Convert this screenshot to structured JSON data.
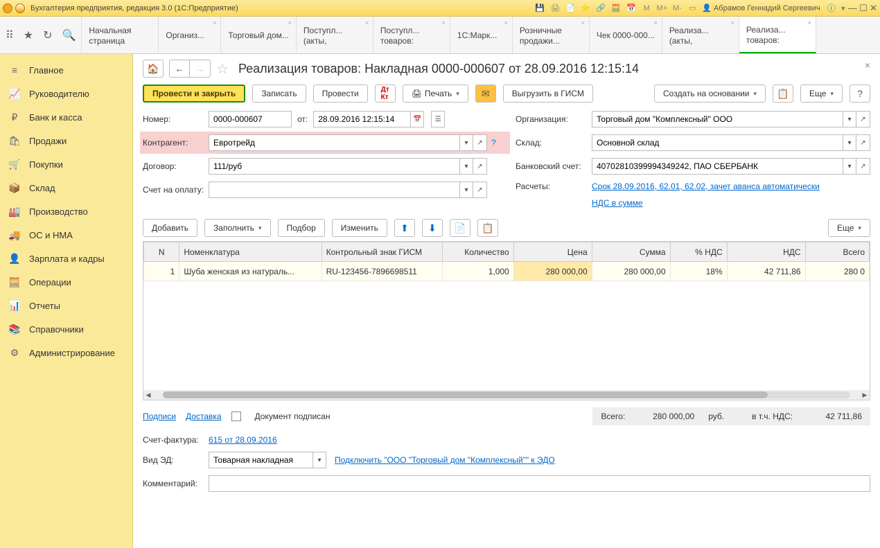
{
  "title": "Бухгалтерия предприятия, редакция 3.0  (1С:Предприятие)",
  "user": "Абрамов Геннадий Сергеевич",
  "toolbarGlyphs": {
    "m": "М",
    "mplus": "М+",
    "mminus": "М-"
  },
  "tabs": [
    {
      "label": "Начальная страница"
    },
    {
      "label": "Организ..."
    },
    {
      "label": "Торговый дом..."
    },
    {
      "label": "Поступл... (акты,"
    },
    {
      "label": "Поступл... товаров:"
    },
    {
      "label": "1С:Марк..."
    },
    {
      "label": "Розничные продажи..."
    },
    {
      "label": "Чек 0000-000..."
    },
    {
      "label": "Реализа... (акты,"
    },
    {
      "label": "Реализа... товаров:"
    }
  ],
  "sidebar": [
    {
      "icon": "≡",
      "label": "Главное"
    },
    {
      "icon": "📈",
      "label": "Руководителю"
    },
    {
      "icon": "₽",
      "label": "Банк и касса"
    },
    {
      "icon": "🛍",
      "label": "Продажи"
    },
    {
      "icon": "🛒",
      "label": "Покупки"
    },
    {
      "icon": "📦",
      "label": "Склад"
    },
    {
      "icon": "🏭",
      "label": "Производство"
    },
    {
      "icon": "🚚",
      "label": "ОС и НМА"
    },
    {
      "icon": "👤",
      "label": "Зарплата и кадры"
    },
    {
      "icon": "🧮",
      "label": "Операции"
    },
    {
      "icon": "📊",
      "label": "Отчеты"
    },
    {
      "icon": "📚",
      "label": "Справочники"
    },
    {
      "icon": "⚙",
      "label": "Администрирование"
    }
  ],
  "page": {
    "title": "Реализация товаров: Накладная 0000-000607 от 28.09.2016 12:15:14"
  },
  "actions": {
    "postClose": "Провести и закрыть",
    "write": "Записать",
    "post": "Провести",
    "print": "Печать",
    "gism": "Выгрузить в ГИСМ",
    "createBased": "Создать на основании",
    "more": "Еще"
  },
  "form": {
    "numberLabel": "Номер:",
    "number": "0000-000607",
    "fromLabel": "от:",
    "date": "28.09.2016 12:15:14",
    "orgLabel": "Организация:",
    "org": "Торговый дом \"Комплексный\" ООО",
    "counterLabel": "Контрагент:",
    "counter": "Евротрейд",
    "warehouseLabel": "Склад:",
    "warehouse": "Основной склад",
    "contractLabel": "Договор:",
    "contract": "111/руб",
    "bankLabel": "Банковский счет:",
    "bank": "40702810399994349242, ПАО СБЕРБАНК",
    "invoiceLabel": "Счет на оплату:",
    "invoice": "",
    "calcLabel": "Расчеты:",
    "calcLink": "Срок 28.09.2016, 62.01, 62.02, зачет аванса автоматически",
    "vatLink": "НДС в сумме"
  },
  "ttool": {
    "add": "Добавить",
    "fill": "Заполнить",
    "select": "Подбор",
    "edit": "Изменить",
    "more": "Еще"
  },
  "cols": {
    "n": "N",
    "item": "Номенклатура",
    "gism": "Контрольный знак ГИСМ",
    "qty": "Количество",
    "price": "Цена",
    "sum": "Сумма",
    "vatp": "% НДС",
    "vat": "НДС",
    "total": "Всего"
  },
  "row": {
    "n": "1",
    "item": "Шуба женская из натураль...",
    "gism": "RU-123456-7896698511",
    "qty": "1,000",
    "price": "280 000,00",
    "sum": "280 000,00",
    "vatp": "18%",
    "vat": "42 711,86",
    "total": "280 0"
  },
  "footer": {
    "sign": "Подписи",
    "delivery": "Доставка",
    "signed": "Документ подписан",
    "totalLabel": "Всего:",
    "total": "280 000,00",
    "cur": "руб.",
    "vatLabel": "в т.ч. НДС:",
    "vat": "42 711,86",
    "sfLabel": "Счет-фактура:",
    "sfLink": "615 от 28.09.2016",
    "edLabel": "Вид ЭД:",
    "edValue": "Товарная накладная",
    "edLink": "Подключить \"ООО \"Торговый дом \"Комплексный\"\" к ЭДО",
    "commentLabel": "Комментарий:",
    "comment": ""
  }
}
